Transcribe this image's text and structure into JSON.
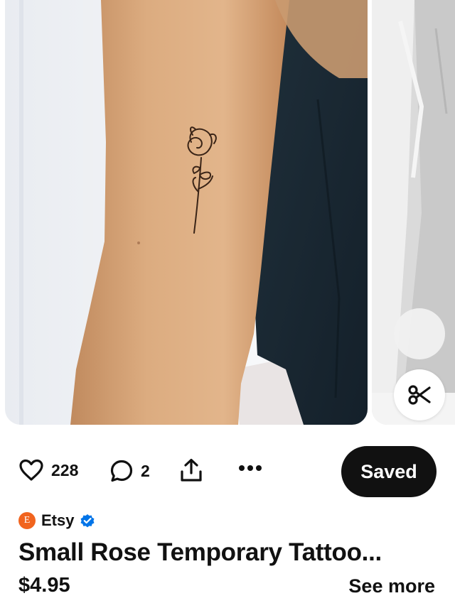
{
  "pin": {
    "image_alt": "Small rose tattoo on upper arm",
    "colors": {
      "accent": "#111111",
      "etsy_orange": "#f1641e",
      "verified_blue": "#0074e8"
    }
  },
  "overlays": {
    "crop_icon": "scissors-icon"
  },
  "actions": {
    "likes": "228",
    "comments": "2",
    "save_label": "Saved"
  },
  "creator": {
    "avatar_letter": "E",
    "name": "Etsy",
    "verified_icon": "verified-badge-icon"
  },
  "product": {
    "title": "Small Rose Temporary Tattoo...",
    "price": "$4.95",
    "see_more": "See more"
  }
}
